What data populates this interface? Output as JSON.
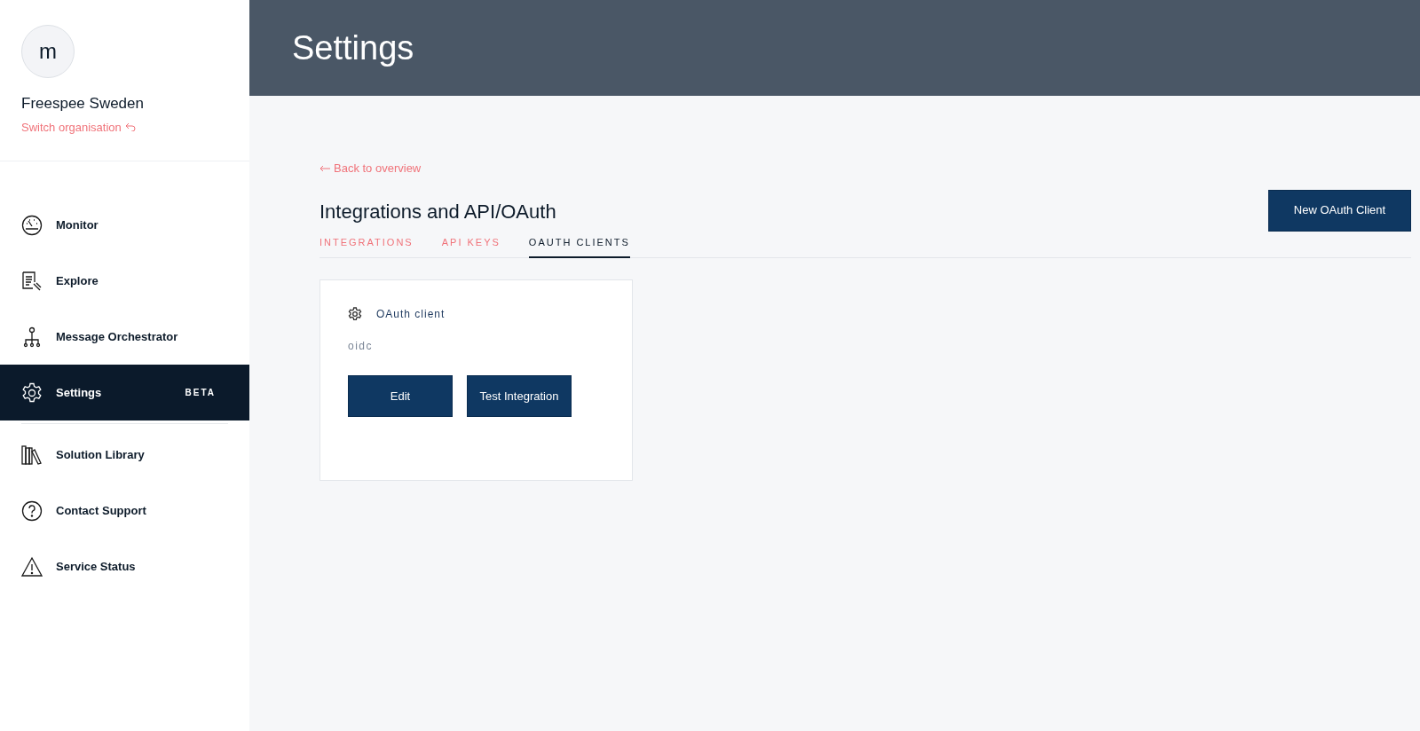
{
  "sidebar": {
    "avatar_letter": "m",
    "organisation": "Freespee Sweden",
    "switch_link": "Switch organisation",
    "items": [
      {
        "kind": "gauge",
        "label": "Monitor",
        "selected": false
      },
      {
        "kind": "document",
        "label": "Explore",
        "selected": false
      },
      {
        "kind": "tree",
        "label": "Message Orchestrator",
        "selected": false
      },
      {
        "kind": "gear",
        "label": "Settings",
        "badge": "BETA",
        "selected": true
      },
      {
        "kind": "divider"
      },
      {
        "kind": "books",
        "label": "Solution Library",
        "selected": false
      },
      {
        "kind": "question",
        "label": "Contact Support",
        "selected": false
      },
      {
        "kind": "warning",
        "label": "Service Status",
        "selected": false
      }
    ]
  },
  "header": {
    "title": "Settings"
  },
  "content": {
    "back_link": "Back to overview",
    "title": "Integrations and API/OAuth",
    "new_button": "New OAuth Client",
    "tabs": [
      {
        "label": "INTEGRATIONS",
        "selected": false
      },
      {
        "label": "API KEYS",
        "selected": false
      },
      {
        "label": "OAUTH CLIENTS",
        "selected": true
      }
    ],
    "cards": [
      {
        "title": "OAuth client",
        "name": "oidc",
        "buttons": [
          "Edit",
          "Test Integration"
        ]
      }
    ]
  }
}
